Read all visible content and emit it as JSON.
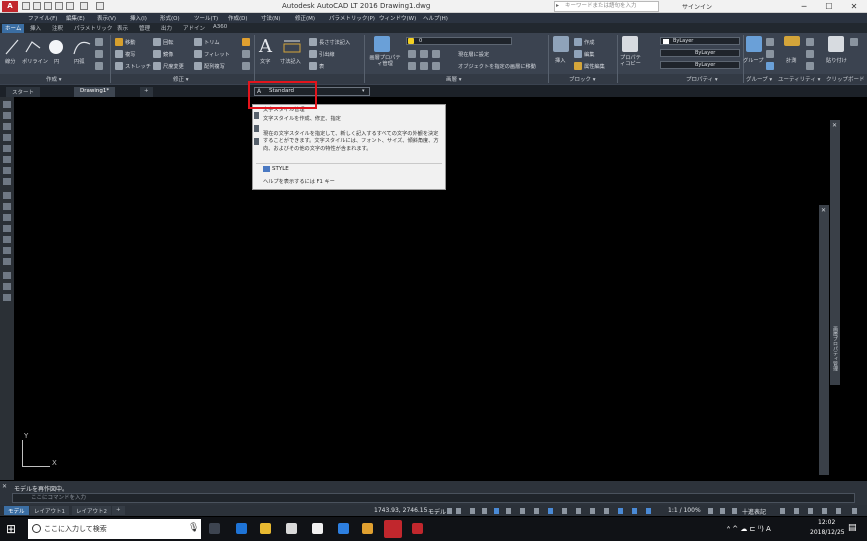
{
  "window": {
    "app_logo": "A",
    "title": "Autodesk AutoCAD LT 2016    Drawing1.dwg",
    "search_placeholder": "キーワードまたは語句を入力",
    "signin": "サインイン",
    "minimize": "─",
    "restore": "☐",
    "close": "✕"
  },
  "menu": [
    "ファイル(F)",
    "編集(E)",
    "表示(V)",
    "挿入(I)",
    "形式(O)",
    "ツール(T)",
    "作成(D)",
    "寸法(N)",
    "修正(M)",
    "パラメトリック(P)",
    "ウィンドウ(W)",
    "ヘルプ(H)"
  ],
  "ribbon_tabs": [
    "ホーム",
    "挿入",
    "注釈",
    "パラメトリック",
    "表示",
    "管理",
    "出力",
    "アドイン",
    "A360"
  ],
  "ribbon": {
    "draw": {
      "line": "線分",
      "polyline": "ポリライン",
      "circle": "円",
      "arc": "円弧",
      "panel": "作成 ▾"
    },
    "modify": {
      "move": "移動",
      "rotate": "回転",
      "trim": "トリム",
      "copy": "複写",
      "mirror": "鏡像",
      "fillet": "フィレット",
      "stretch": "ストレッチ",
      "scale": "尺度変更",
      "array": "配列複写",
      "panel": "修正 ▾"
    },
    "annotation": {
      "text": "文字",
      "dimension": "寸法記入",
      "linear": "長さ寸法記入",
      "leader": "引出線",
      "table": "表"
    },
    "layers": {
      "layer_props": "画層プロパティ管理",
      "layer_current": "0",
      "set_current": "現在層に設定",
      "match_layer": "オブジェクトを指定の画層に移動",
      "panel": "画層 ▾"
    },
    "block": {
      "insert": "挿入",
      "create": "作成",
      "edit": "編集",
      "attr_edit": "属性編集",
      "panel": "ブロック ▾"
    },
    "properties": {
      "match": "プロパティコピー",
      "color": "ByLayer",
      "linetype": "ByLayer",
      "lineweight": "ByLayer",
      "panel": "プロパティ ▾"
    },
    "groups": {
      "group": "グループ",
      "panel": "グループ ▾"
    },
    "utilities": {
      "measure": "計測",
      "panel": "ユーティリティ ▾"
    },
    "clipboard": {
      "paste": "貼り付け",
      "panel": "クリップボード"
    }
  },
  "file_tabs": [
    "スタート",
    "Drawing1*",
    "+"
  ],
  "text_style": {
    "current": "Standard",
    "tooltip_title": "文字スタイル管理",
    "tooltip_sub": "文字スタイルを作成、修正、指定",
    "tooltip_desc": "現在の文字スタイルを指定して、新しく記入するすべての文字の外観を決定することができます。文字スタイルには、フォント、サイズ、傾斜角度、方向、およびその他の文字の特性が含まれます。",
    "command": "STYLE",
    "help": "ヘルプを表示するには F1 キー"
  },
  "ucs": {
    "x": "X",
    "y": "Y"
  },
  "palette": {
    "title": "画層プロパティ管理"
  },
  "command_line": {
    "history": "モデルを再作図中。",
    "placeholder": "ここにコマンドを入力"
  },
  "layout_tabs": [
    "モデル",
    "レイアウト1",
    "レイアウト2",
    "+"
  ],
  "status": {
    "coords": "1743.93, 2746.15",
    "space": "モデル",
    "scale": "1:1 / 100%",
    "crosshair": "十進表記"
  },
  "taskbar": {
    "search": "ここに入力して検索",
    "time": "12:02",
    "date": "2018/12/25",
    "tray": "ᴬ  ^  ☁  ⊏  ⁾⁾)  A"
  },
  "colors": {
    "accent": "#3b6ea3",
    "highlight": "#e3141c",
    "background": "#000000"
  }
}
